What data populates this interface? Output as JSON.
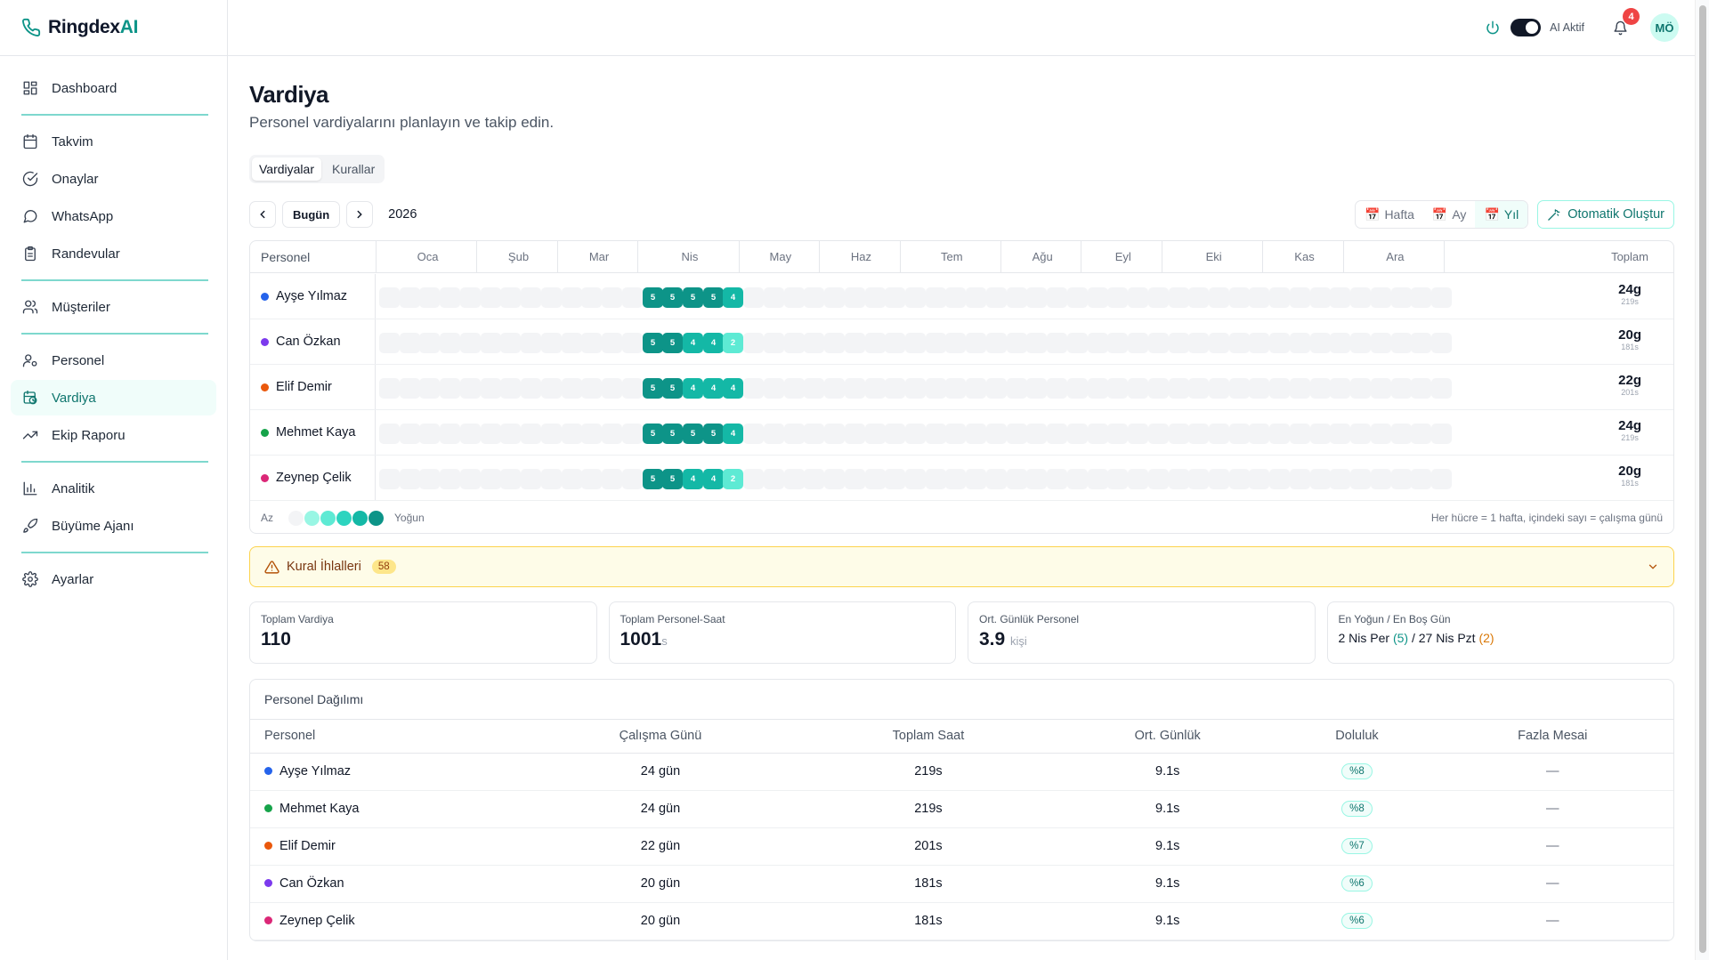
{
  "app": {
    "name_main": "Ringdex",
    "name_ai": "AI"
  },
  "sidebar": {
    "items": [
      {
        "label": "Dashboard",
        "icon": "grid-icon"
      },
      {
        "label": "Takvim",
        "icon": "calendar-icon"
      },
      {
        "label": "Onaylar",
        "icon": "check-circle-icon"
      },
      {
        "label": "WhatsApp",
        "icon": "chat-icon"
      },
      {
        "label": "Randevular",
        "icon": "clipboard-icon"
      },
      {
        "label": "Müşteriler",
        "icon": "users-icon"
      },
      {
        "label": "Personel",
        "icon": "user-icon"
      },
      {
        "label": "Vardiya",
        "icon": "calendar-clock-icon",
        "active": true
      },
      {
        "label": "Ekip Raporu",
        "icon": "trend-icon"
      },
      {
        "label": "Analitik",
        "icon": "bar-chart-icon"
      },
      {
        "label": "Büyüme Ajanı",
        "icon": "rocket-icon"
      },
      {
        "label": "Ayarlar",
        "icon": "gear-icon"
      }
    ]
  },
  "header": {
    "ai_label": "AI Aktif",
    "notif_count": "4",
    "avatar": "MÖ"
  },
  "page": {
    "title": "Vardiya",
    "subtitle": "Personel vardiyalarını planlayın ve takip edin."
  },
  "tabs": [
    "Vardiyalar",
    "Kurallar"
  ],
  "toolbar": {
    "today": "Bugün",
    "year": "2026",
    "views": [
      "Hafta",
      "Ay",
      "Yıl"
    ],
    "auto": "Otomatik Oluştur"
  },
  "grid": {
    "col_personel": "Personel",
    "col_total": "Toplam",
    "months": [
      "Oca",
      "Şub",
      "Mar",
      "Nis",
      "May",
      "Haz",
      "Tem",
      "Ağu",
      "Eyl",
      "Eki",
      "Kas",
      "Ara"
    ],
    "rows": [
      {
        "name": "Ayşe Yılmaz",
        "color": "#2563eb",
        "weeks": [
          5,
          5,
          5,
          5,
          4
        ],
        "total": "24g",
        "hours": "219s"
      },
      {
        "name": "Can Özkan",
        "color": "#7c3aed",
        "weeks": [
          5,
          5,
          4,
          4,
          2
        ],
        "total": "20g",
        "hours": "181s"
      },
      {
        "name": "Elif Demir",
        "color": "#ea580c",
        "weeks": [
          5,
          5,
          4,
          4,
          4
        ],
        "total": "22g",
        "hours": "201s"
      },
      {
        "name": "Mehmet Kaya",
        "color": "#16a34a",
        "weeks": [
          5,
          5,
          5,
          5,
          4
        ],
        "total": "24g",
        "hours": "219s"
      },
      {
        "name": "Zeynep Çelik",
        "color": "#db2777",
        "weeks": [
          5,
          5,
          4,
          4,
          2
        ],
        "total": "20g",
        "hours": "181s"
      }
    ],
    "legend_low": "Az",
    "legend_high": "Yoğun",
    "legend_note": "Her hücre = 1 hafta, içindeki sayı = çalışma günü"
  },
  "alert": {
    "label": "Kural İhlalleri",
    "count": "58"
  },
  "stats": {
    "total_shifts": {
      "label": "Toplam Vardiya",
      "value": "110"
    },
    "person_hours": {
      "label": "Toplam Personel-Saat",
      "value": "1001",
      "unit": "s"
    },
    "avg_daily": {
      "label": "Ort. Günlük Personel",
      "value": "3.9",
      "unit": "kişi"
    },
    "busiest": {
      "label": "En Yoğun / En Boş Gün",
      "busy_day": "2 Nis Per",
      "busy_count": "(5)",
      "sep": "/",
      "quiet_day": "27 Nis Pzt",
      "quiet_count": "(2)"
    }
  },
  "distribution": {
    "title": "Personel Dağılımı",
    "headers": [
      "Personel",
      "Çalışma Günü",
      "Toplam Saat",
      "Ort. Günlük",
      "Doluluk",
      "Fazla Mesai"
    ],
    "rows": [
      {
        "name": "Ayşe Yılmaz",
        "color": "#2563eb",
        "days": "24 gün",
        "hours": "219s",
        "avg": "9.1s",
        "occ": "%8",
        "ot": "—"
      },
      {
        "name": "Mehmet Kaya",
        "color": "#16a34a",
        "days": "24 gün",
        "hours": "219s",
        "avg": "9.1s",
        "occ": "%8",
        "ot": "—"
      },
      {
        "name": "Elif Demir",
        "color": "#ea580c",
        "days": "22 gün",
        "hours": "201s",
        "avg": "9.1s",
        "occ": "%7",
        "ot": "—"
      },
      {
        "name": "Can Özkan",
        "color": "#7c3aed",
        "days": "20 gün",
        "hours": "181s",
        "avg": "9.1s",
        "occ": "%6",
        "ot": "—"
      },
      {
        "name": "Zeynep Çelik",
        "color": "#db2777",
        "days": "20 gün",
        "hours": "181s",
        "avg": "9.1s",
        "occ": "%6",
        "ot": "—"
      }
    ]
  },
  "colors": {
    "accent": "#0d9488",
    "level5": "#0d9488",
    "level4": "#14b8a6",
    "level2": "#5eead4"
  }
}
